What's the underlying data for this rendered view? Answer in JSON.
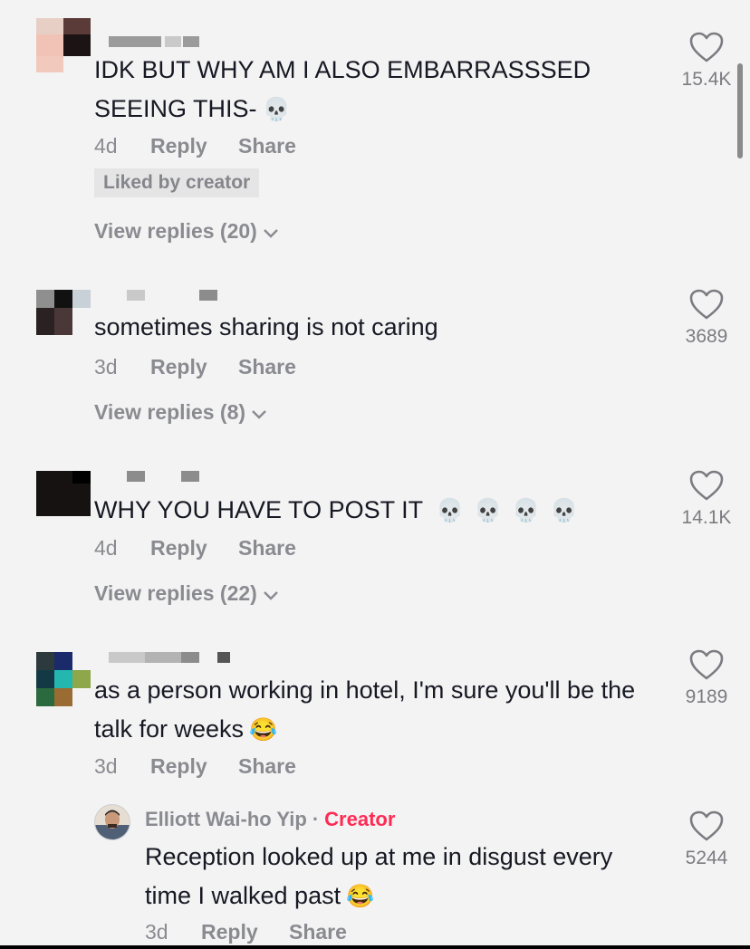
{
  "comments": [
    {
      "text": "IDK BUT WHY AM I ALSO EMBARRASSSED SEEING THIS-",
      "emoji": "💀",
      "age": "4d",
      "reply_label": "Reply",
      "share_label": "Share",
      "liked_badge": "Liked by creator",
      "view_replies": "View replies (20)",
      "likes": "15.4K"
    },
    {
      "text": "sometimes sharing is not caring",
      "age": "3d",
      "reply_label": "Reply",
      "share_label": "Share",
      "view_replies": "View replies (8)",
      "likes": "3689"
    },
    {
      "text": "WHY YOU HAVE TO POST IT",
      "emoji": "💀 💀 💀 💀",
      "age": "4d",
      "reply_label": "Reply",
      "share_label": "Share",
      "view_replies": "View replies (22)",
      "likes": "14.1K"
    },
    {
      "text": "as a person working in hotel, I'm sure you'll be the talk for weeks",
      "emoji": "😂",
      "age": "3d",
      "reply_label": "Reply",
      "share_label": "Share",
      "likes": "9189"
    }
  ],
  "reply": {
    "author": "Elliott Wai-ho Yip",
    "separator": "·",
    "badge": "Creator",
    "text": "Reception looked up at me in disgust every time I walked past",
    "emoji": "😂",
    "age": "3d",
    "reply_label": "Reply",
    "share_label": "Share",
    "likes": "5244"
  },
  "icons": {
    "like": "heart-outline-icon",
    "expand": "chevron-down-icon"
  },
  "colors": {
    "background": "#f4f3f3",
    "text": "#161823",
    "meta": "#8a8b91",
    "creator_accent": "#fe2c55"
  }
}
